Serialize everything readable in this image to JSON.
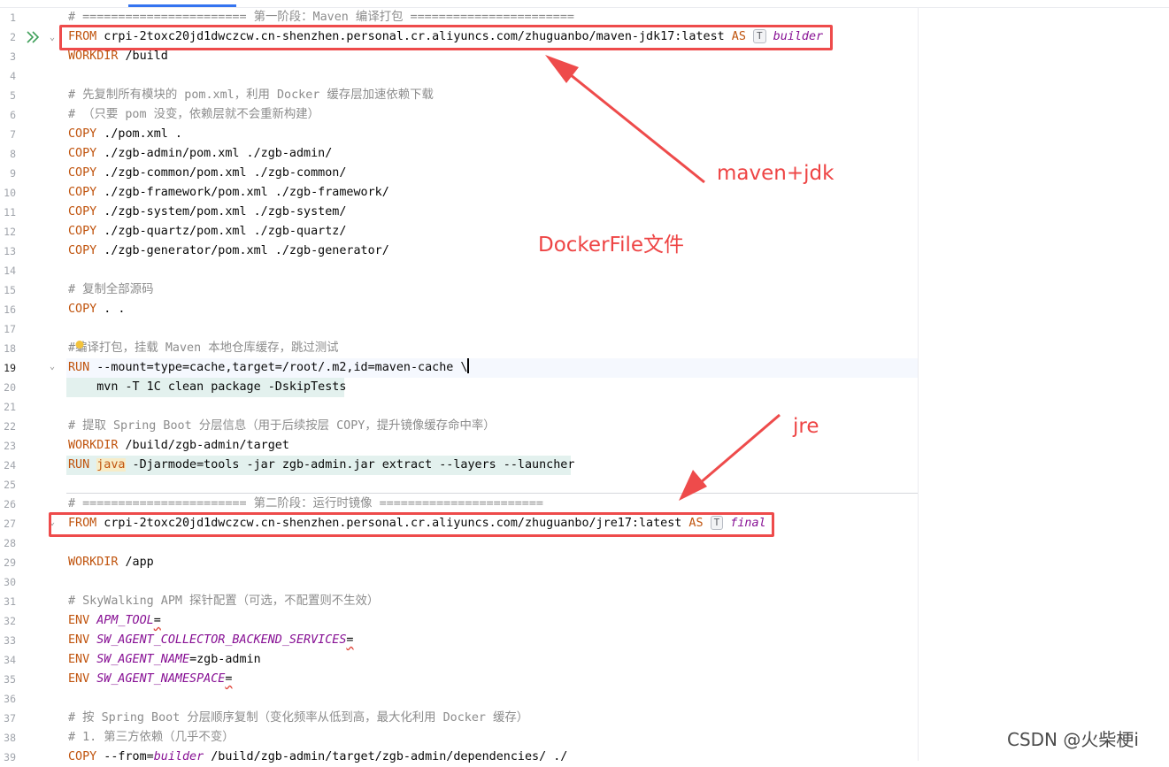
{
  "editor": {
    "current_line": 19,
    "line_numbers": [
      "1",
      "2",
      "3",
      "4",
      "5",
      "6",
      "7",
      "8",
      "9",
      "10",
      "11",
      "12",
      "13",
      "14",
      "15",
      "16",
      "17",
      "18",
      "19",
      "20",
      "21",
      "22",
      "23",
      "24",
      "25",
      "26",
      "27",
      "28",
      "29",
      "30",
      "31",
      "32",
      "33",
      "34",
      "35",
      "36",
      "37",
      "38",
      "39"
    ],
    "lines": {
      "l1": "# ======================= 第一阶段：Maven 编译打包 =======================",
      "l2_kw": "FROM",
      "l2_image": " crpi-2toxc20jd1dwczcw.cn-shenzhen.personal.cr.aliyuncs.com/zhuguanbo/maven-jdk17:latest ",
      "l2_as": "AS",
      "l2_hint": "T",
      "l2_stage": "builder",
      "l3_kw": "WORKDIR",
      "l3_rest": " /build",
      "l5": "# 先复制所有模块的 pom.xml，利用 Docker 缓存层加速依赖下载",
      "l6": "# （只要 pom 没变，依赖层就不会重新构建）",
      "copy_kw": "COPY",
      "l7_rest": " ./pom.xml .",
      "l8_rest": " ./zgb-admin/pom.xml ./zgb-admin/",
      "l9_rest": " ./zgb-common/pom.xml ./zgb-common/",
      "l10_rest": " ./zgb-framework/pom.xml ./zgb-framework/",
      "l11_rest": " ./zgb-system/pom.xml ./zgb-system/",
      "l12_rest": " ./zgb-quartz/pom.xml ./zgb-quartz/",
      "l13_rest": " ./zgb-generator/pom.xml ./zgb-generator/",
      "l15": "# 复制全部源码",
      "l16_rest": " . .",
      "l18_hash": "#",
      "l18_rest": "编译打包，挂载 Maven 本地仓库缓存，跳过测试",
      "run_kw": "RUN",
      "l19_rest": " --mount=type=cache,target=/root/.m2,id=maven-cache \\",
      "l20": "    mvn -T 1C clean package -DskipTests",
      "l22": "# 提取 Spring Boot 分层信息（用于后续按层 COPY，提升镜像缓存命中率）",
      "l23_kw": "WORKDIR",
      "l23_rest": " /build/zgb-admin/target",
      "l24_java": "java",
      "l24_rest": " -Djarmode=tools -jar zgb-admin.jar extract --layers --launcher",
      "l26": "# ======================= 第二阶段：运行时镜像 =======================",
      "l27_kw": "FROM",
      "l27_image": " crpi-2toxc20jd1dwczcw.cn-shenzhen.personal.cr.aliyuncs.com/zhuguanbo/jre17:latest ",
      "l27_as": "AS",
      "l27_hint": "T",
      "l27_stage": "final",
      "l29_kw": "WORKDIR",
      "l29_rest": " /app",
      "l31": "# SkyWalking APM 探针配置（可选，不配置则不生效）",
      "env_kw": "ENV",
      "l32_var": "APM_TOOL",
      "l33_var": "SW_AGENT_COLLECTOR_BACKEND_SERVICES",
      "l34_var": "SW_AGENT_NAME",
      "l34_val": "zgb-admin",
      "l35_var": "SW_AGENT_NAMESPACE",
      "eq": "=",
      "l37": "# 按 Spring Boot 分层顺序复制（变化频率从低到高，最大化利用 Docker 缓存）",
      "l38": "# 1. 第三方依赖（几乎不变）",
      "l39_kw": "COPY",
      "l39_opt": " --from=",
      "l39_var": "builder",
      "l39_rest": " /build/zgb-admin/target/zgb-admin/dependencies/ ./"
    }
  },
  "annotations": {
    "maven_jdk": "maven+jdk",
    "dockerfile": "DockerFile文件",
    "jre": "jre"
  },
  "watermark": "CSDN @火柴梗i",
  "colors": {
    "keyword": "#c0540e",
    "comment": "#8c8c8c",
    "variable": "#871094",
    "annotation_red": "#ee4b4b",
    "selection": "#e3f1ee",
    "accent": "#3574f0"
  },
  "icons": {
    "run": "run-gutter-icon",
    "intention": "lightbulb-icon",
    "fold": "fold-chevron-icon"
  }
}
